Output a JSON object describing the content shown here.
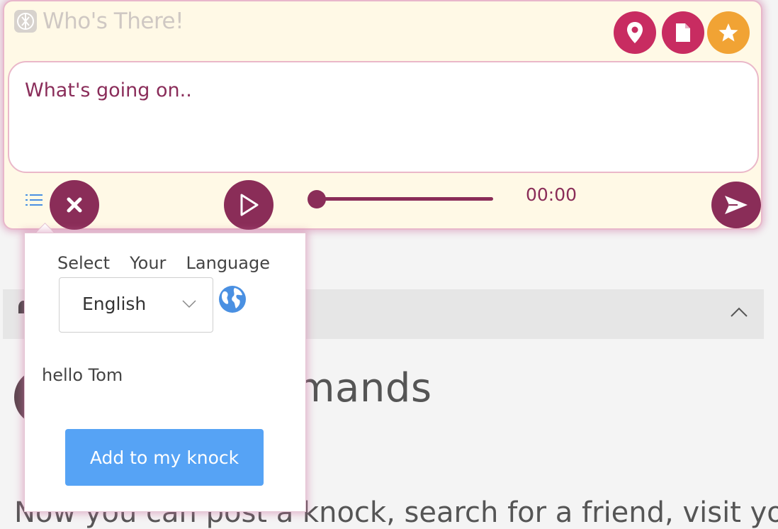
{
  "app": {
    "title": "Who's There!"
  },
  "header_buttons": {
    "location_icon": "location-pin-icon",
    "document_icon": "document-icon",
    "star_icon": "star-icon"
  },
  "composer": {
    "message": "What's going on..",
    "time": "00:00",
    "progress": 0
  },
  "language_popover": {
    "heading_words": [
      "Select",
      "Your",
      "Language"
    ],
    "selected_language": "English",
    "greeting": "hello Tom",
    "add_button": "Add to my knock"
  },
  "background_page": {
    "heading_fragment": "mands",
    "body_fragment": "Now you can post a knock, search for a friend, visit your"
  },
  "colors": {
    "primary": "#8a2d58",
    "pink": "#c82c61",
    "orange": "#f1a334",
    "blue_button": "#56a3f5",
    "widget_bg": "#fff9e6"
  }
}
